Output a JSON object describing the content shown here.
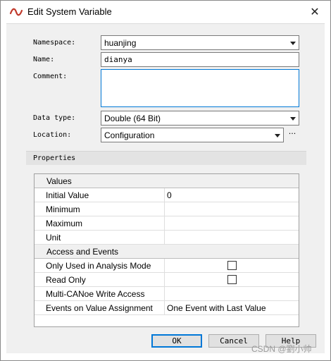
{
  "window": {
    "title": "Edit System Variable",
    "close_glyph": "✕"
  },
  "form": {
    "namespace": {
      "label": "Namespace:",
      "value": "huanjing"
    },
    "name": {
      "label": "Name:",
      "value": "dianya"
    },
    "comment": {
      "label": "Comment:",
      "value": ""
    },
    "data_type": {
      "label": "Data type:",
      "value": "Double (64 Bit)"
    },
    "location": {
      "label": "Location:",
      "value": "Configuration",
      "ellipsis": "···"
    }
  },
  "properties": {
    "header": "Properties",
    "categories": [
      {
        "label": "Values",
        "rows": [
          {
            "name": "Initial Value",
            "value": "0"
          },
          {
            "name": "Minimum",
            "value": ""
          },
          {
            "name": "Maximum",
            "value": ""
          },
          {
            "name": "Unit",
            "value": ""
          }
        ]
      },
      {
        "label": "Access and Events",
        "rows": [
          {
            "name": "Only Used in Analysis Mode",
            "checked": false
          },
          {
            "name": "Read Only",
            "checked": false
          },
          {
            "name": "Multi-CANoe Write Access",
            "value": ""
          },
          {
            "name": "Events on Value Assignment",
            "value": "One Event with Last Value"
          }
        ]
      }
    ]
  },
  "buttons": {
    "ok": "OK",
    "cancel": "Cancel",
    "help": "Help"
  },
  "watermark": "CSDN @劉小帅",
  "icons": {
    "app": "canoe-wave-icon",
    "close": "close-icon",
    "dropdown": "chevron-down-icon"
  },
  "colors": {
    "accent": "#0078d7",
    "app_icon": "#c0392b"
  }
}
